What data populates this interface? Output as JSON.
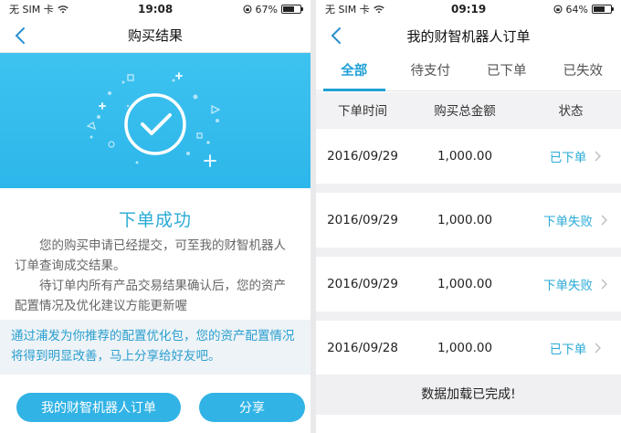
{
  "left": {
    "status": {
      "carrier": "无 SIM 卡",
      "time": "19:08",
      "battery": "67%",
      "battery_level": 0.67
    },
    "nav_title": "购买结果",
    "success_title": "下单成功",
    "message_1": "您的购买申请已经提交，可至我的财智机器人订单查询成交结果。",
    "message_2": "待订单内所有产品交易结果确认后，您的资产配置情况及优化建议方能更新喔",
    "promo": "通过浦发为你推荐的配置优化包，您的资产配置情况将得到明显改善，马上分享给好友吧。",
    "buttons": {
      "orders": "我的财智机器人订单",
      "share": "分享"
    }
  },
  "right": {
    "status": {
      "carrier": "无 SIM 卡",
      "time": "09:19",
      "battery": "64%",
      "battery_level": 0.64
    },
    "nav_title": "我的财智机器人订单",
    "tabs": [
      "全部",
      "待支付",
      "已下单",
      "已失效"
    ],
    "table": {
      "headers": [
        "下单时间",
        "购买总金额",
        "状态"
      ],
      "rows": [
        {
          "date": "2016/09/29",
          "amount": "1,000.00",
          "status": "已下单"
        },
        {
          "date": "2016/09/29",
          "amount": "1,000.00",
          "status": "下单失败"
        },
        {
          "date": "2016/09/29",
          "amount": "1,000.00",
          "status": "下单失败"
        },
        {
          "date": "2016/09/28",
          "amount": "1,000.00",
          "status": "已下单"
        }
      ]
    },
    "footer": "数据加载已完成!"
  },
  "colors": {
    "accent": "#2aaad6",
    "hero": "#3ec3f0",
    "button": "#32b3e6"
  }
}
